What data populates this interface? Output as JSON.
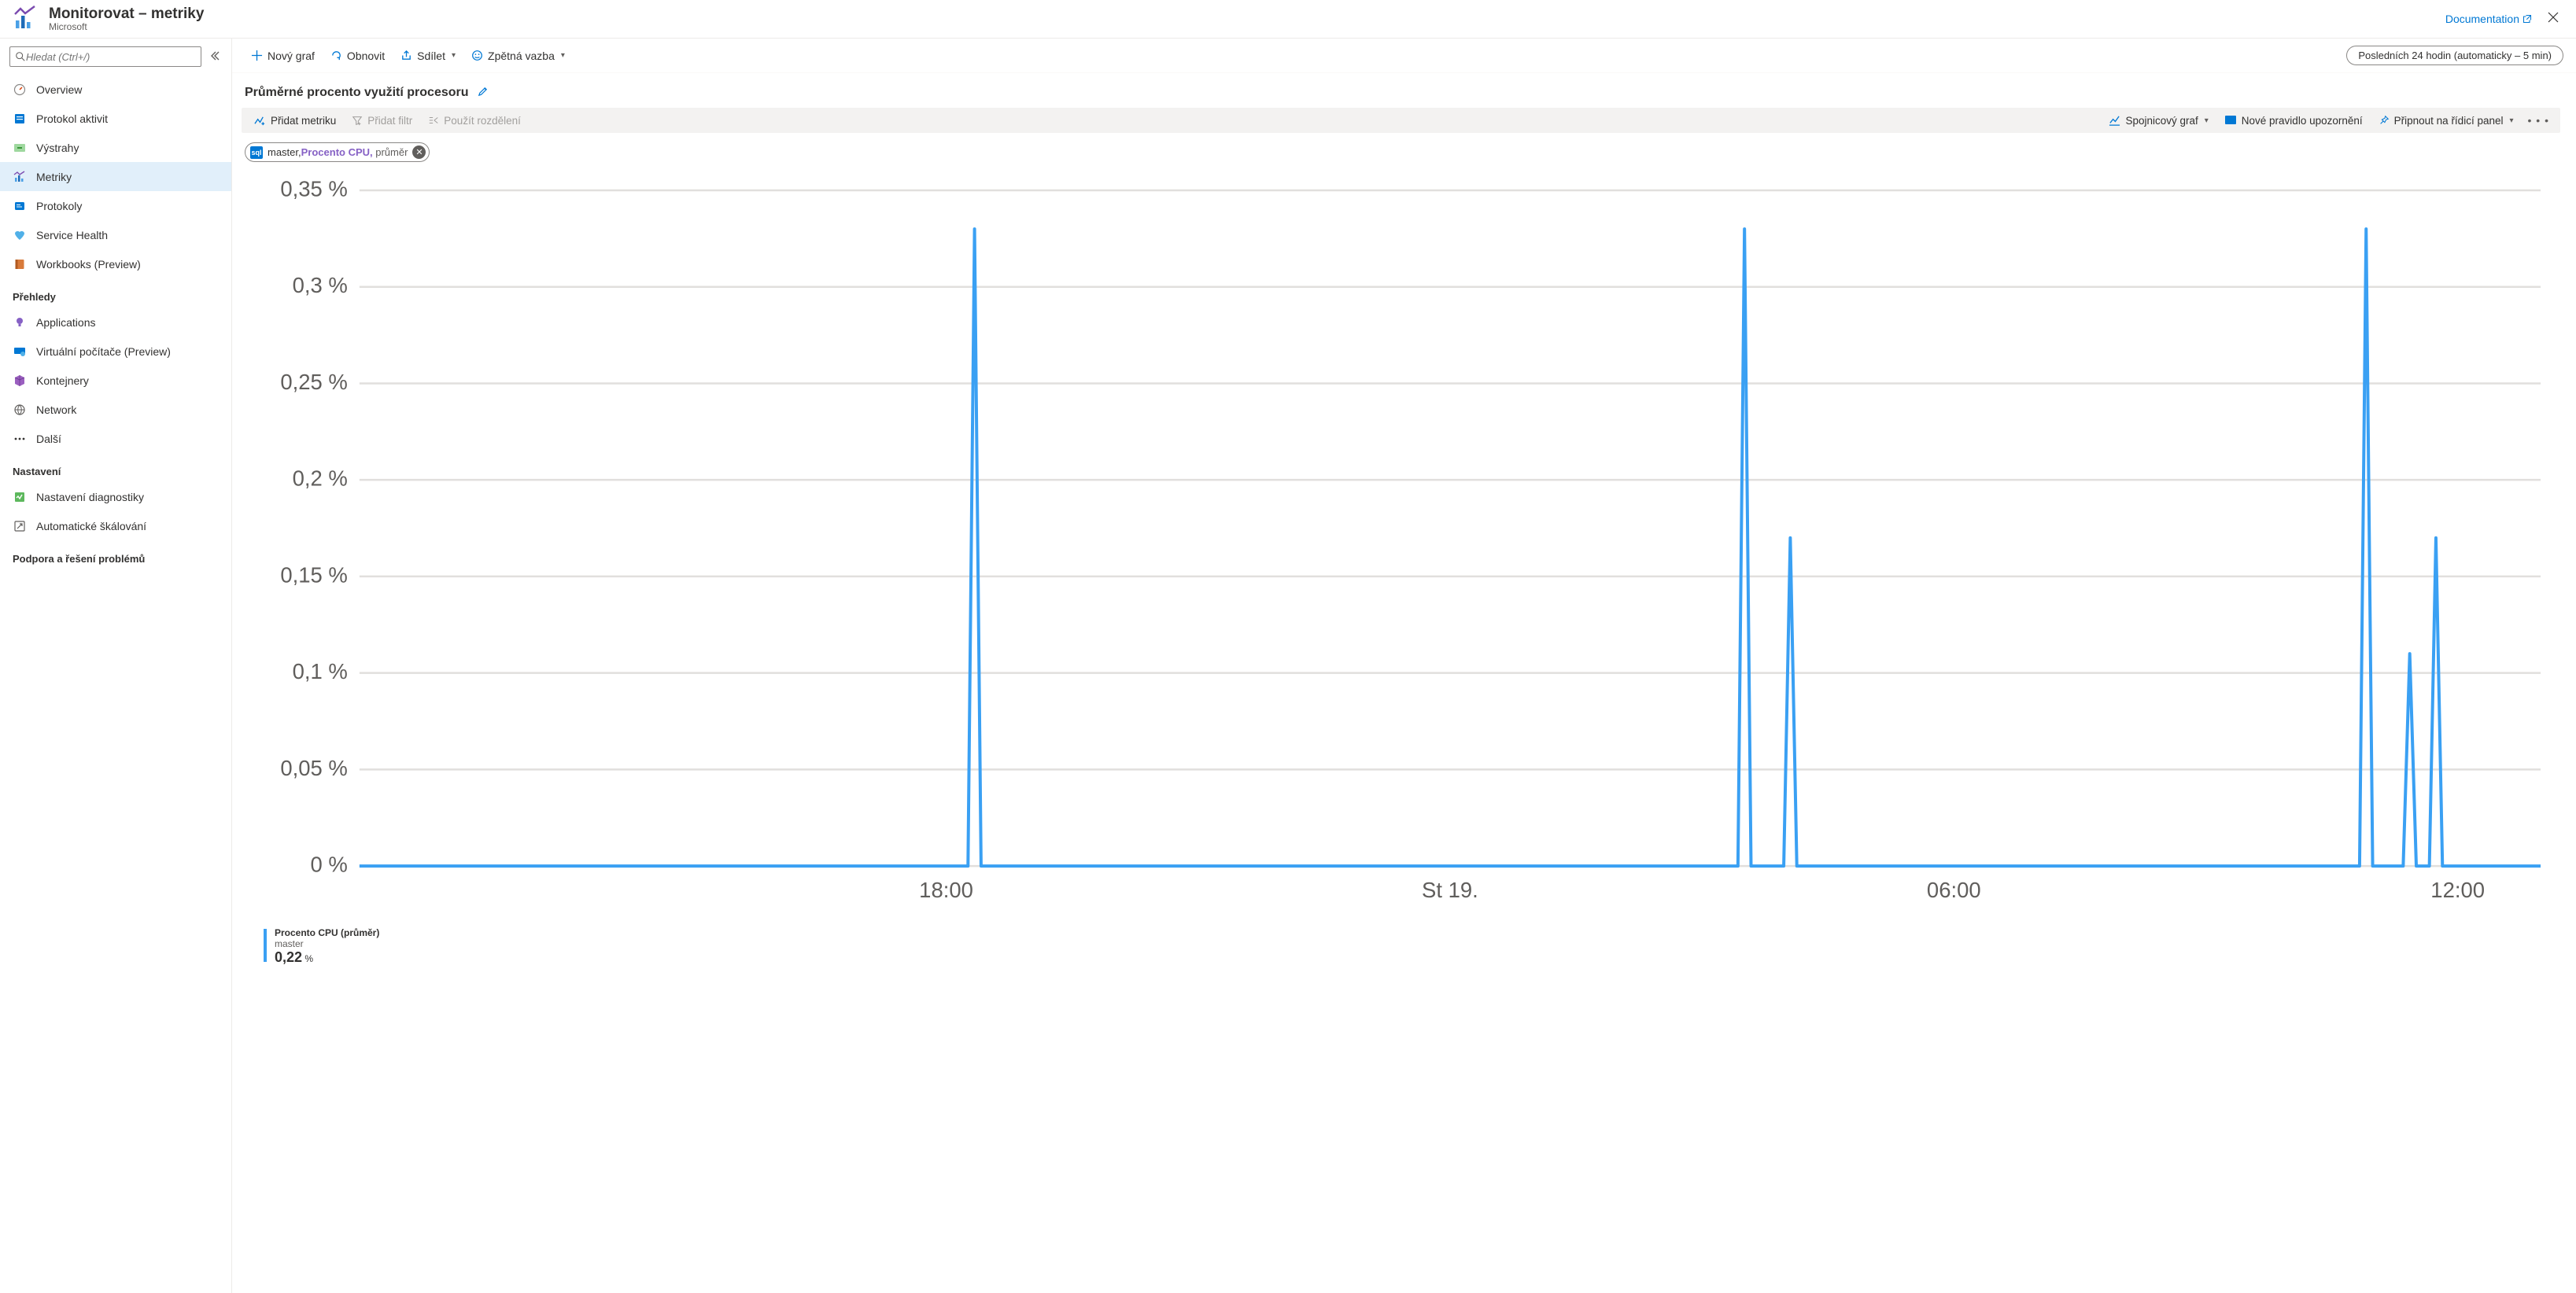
{
  "header": {
    "title": "Monitorovat – metriky",
    "subtitle": "Microsoft",
    "doc_link": "Documentation"
  },
  "search": {
    "placeholder": "Hledat (Ctrl+/)"
  },
  "sidebar": {
    "items_main": [
      {
        "label": "Overview"
      },
      {
        "label": "Protokol aktivit"
      },
      {
        "label": "Výstrahy"
      },
      {
        "label": "Metriky"
      },
      {
        "label": "Protokoly"
      },
      {
        "label": "Service Health"
      },
      {
        "label": "Workbooks (Preview)"
      }
    ],
    "section_prehledy": "Přehledy",
    "items_prehledy": [
      {
        "label": "Applications"
      },
      {
        "label": "Virtuální počítače (Preview)"
      },
      {
        "label": "Kontejnery"
      },
      {
        "label": "Network"
      },
      {
        "label": "Další"
      }
    ],
    "section_nastaveni": "Nastavení",
    "items_nastaveni": [
      {
        "label": "Nastavení diagnostiky"
      },
      {
        "label": "Automatické škálování"
      }
    ],
    "section_podpora": "Podpora a řešení problémů"
  },
  "cmdbar": {
    "new_chart": "Nový graf",
    "refresh": "Obnovit",
    "share": "Sdílet",
    "feedback": "Zpětná vazba",
    "time_range": "Posledních 24 hodin (automaticky – 5 min)"
  },
  "chart": {
    "title": "Průměrné procento využití procesoru",
    "add_metric": "Přidat metriku",
    "add_filter": "Přidat filtr",
    "apply_split": "Použít rozdělení",
    "chart_type": "Spojnicový graf",
    "new_alert": "Nové pravidlo upozornění",
    "pin": "Připnout na řídicí panel",
    "pill_db": "master,",
    "pill_metric": "Procento CPU,",
    "pill_agg": " průměr",
    "legend_line1": "Procento CPU (průměr)",
    "legend_line2": "master",
    "legend_value": "0,22",
    "legend_unit": " %"
  },
  "chart_data": {
    "type": "line",
    "title": "Průměrné procento využití procesoru",
    "ylabel": "%",
    "ylim": [
      0,
      0.35
    ],
    "y_ticks": [
      "0 %",
      "0,05 %",
      "0,1 %",
      "0,15 %",
      "0,2 %",
      "0,25 %",
      "0,3 %",
      "0,35 %"
    ],
    "x_ticks": [
      "18:00",
      "St 19.",
      "06:00",
      "12:00"
    ],
    "x_tick_positions": [
      0.269,
      0.5,
      0.731,
      0.962
    ],
    "series": [
      {
        "name": "master — Procento CPU (průměr)",
        "spikes": [
          {
            "x": 0.282,
            "y": 0.33
          },
          {
            "x": 0.635,
            "y": 0.33
          },
          {
            "x": 0.656,
            "y": 0.17
          },
          {
            "x": 0.92,
            "y": 0.33
          },
          {
            "x": 0.94,
            "y": 0.11
          },
          {
            "x": 0.952,
            "y": 0.17
          }
        ]
      }
    ],
    "summary_avg_percent": 0.22
  }
}
